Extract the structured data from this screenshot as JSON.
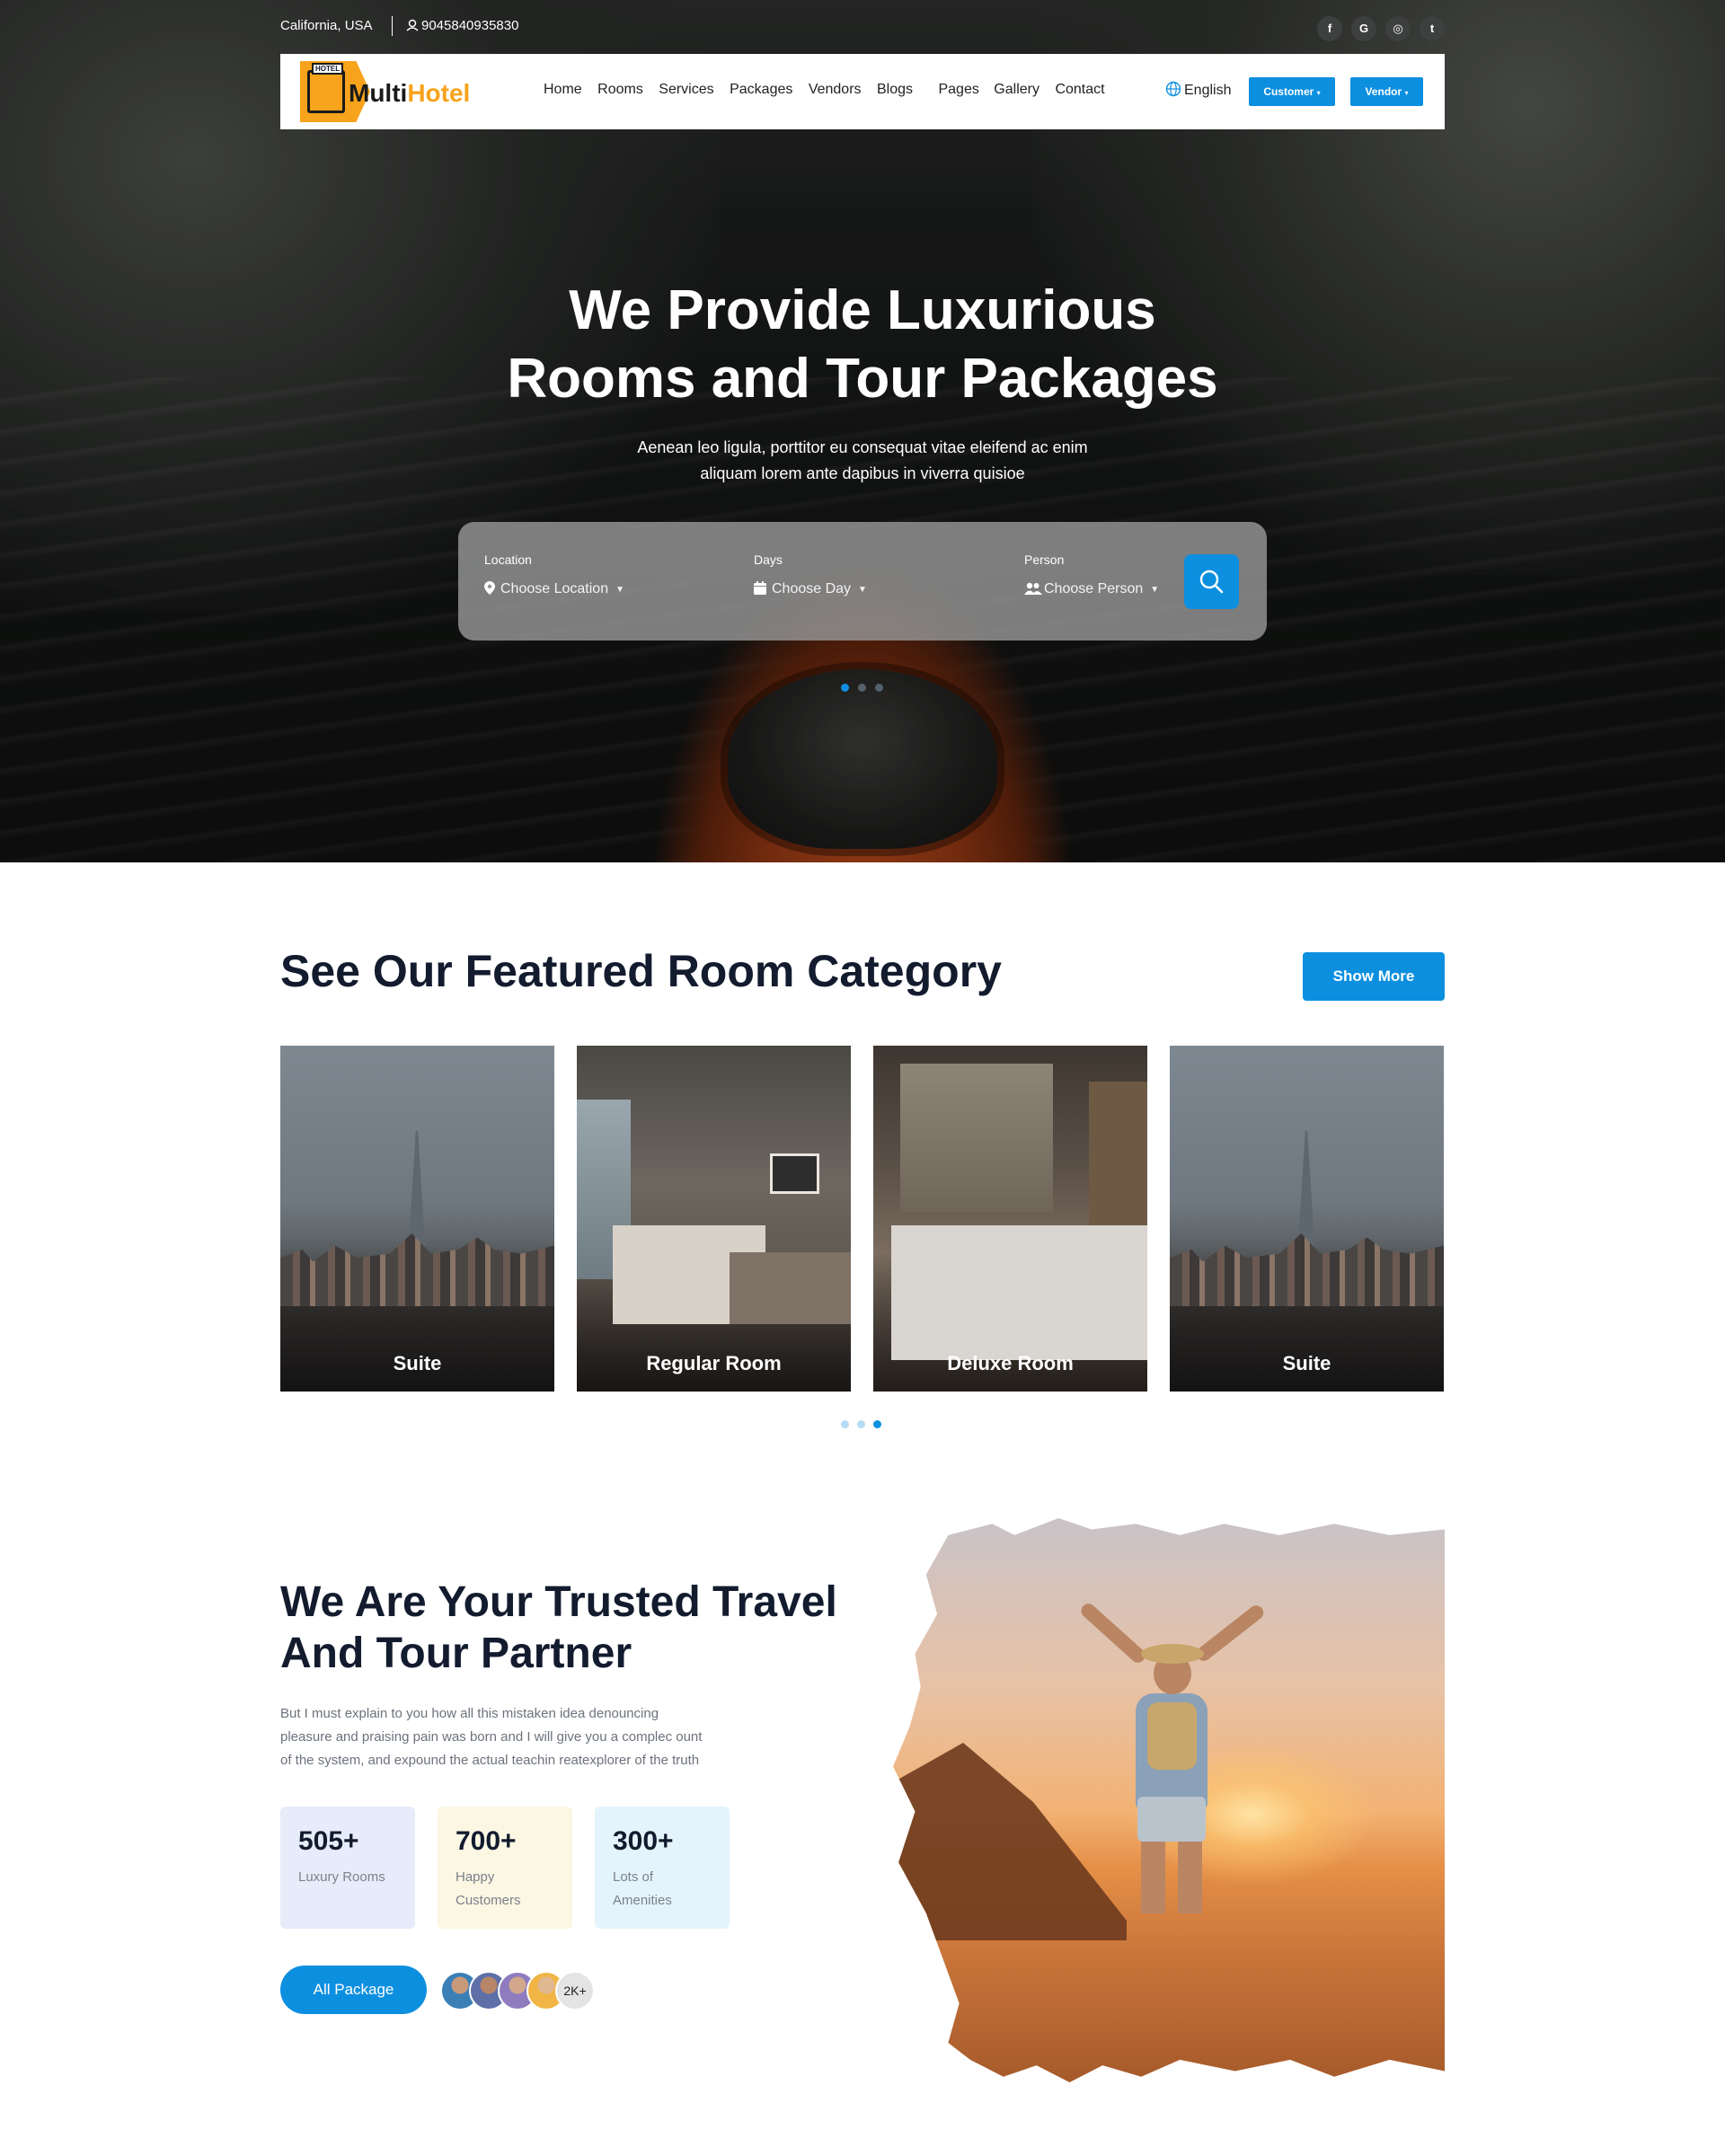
{
  "topbar": {
    "location": "California, USA",
    "phone": "9045840935830",
    "socials": [
      {
        "icon": "facebook-icon",
        "glyph": "f"
      },
      {
        "icon": "google-icon",
        "glyph": "G"
      },
      {
        "icon": "instagram-icon",
        "glyph": "◎"
      },
      {
        "icon": "twitter-icon",
        "glyph": "t"
      }
    ]
  },
  "nav": {
    "logo": {
      "tag": "HOTEL",
      "name_prefix": "Multi",
      "name_suffix": "Hotel"
    },
    "items": [
      "Home",
      "Rooms",
      "Services",
      "Packages",
      "Vendors",
      "Blogs",
      "Pages",
      "Gallery",
      "Contact"
    ],
    "language": "English",
    "customer_label": "Customer",
    "vendor_label": "Vendor"
  },
  "hero": {
    "title_line1": "We Provide Luxurious",
    "title_line2": "Rooms and Tour Packages",
    "subtitle_line1": "Aenean leo ligula, porttitor eu consequat vitae eleifend ac enim",
    "subtitle_line2": "aliquam lorem ante dapibus in viverra quisioe",
    "search": {
      "location_label": "Location",
      "location_value": "Choose Location",
      "days_label": "Days",
      "days_value": "Choose Day",
      "person_label": "Person",
      "person_value": "Choose Person"
    },
    "slides": 3,
    "active_slide": 1
  },
  "featured": {
    "title": "See Our Featured Room Category",
    "show_more": "Show More",
    "cards": [
      "Suite",
      "Regular Room",
      "Deluxe Room",
      "Suite"
    ],
    "pages": 3,
    "active_page": 3
  },
  "trusted": {
    "title_line1": "We Are Your Trusted Travel",
    "title_line2": "And Tour Partner",
    "text_line1": "But I must explain to you how all this mistaken idea denouncing",
    "text_line2": "pleasure and praising pain was born and I will give you a complec ount",
    "text_line3": "of the system, and expound the actual teachin reatexplorer of the truth",
    "stats": [
      {
        "num": "505+",
        "line1": "Luxury Rooms",
        "line2": ""
      },
      {
        "num": "700+",
        "line1": "Happy",
        "line2": "Customers"
      },
      {
        "num": "300+",
        "line1": "Lots of",
        "line2": "Amenities"
      }
    ],
    "button": "All Package",
    "avatar_more": "2K+"
  },
  "colors": {
    "accent": "#0d8fe0",
    "brand_orange": "#f7a31c",
    "heading": "#131b2e"
  }
}
